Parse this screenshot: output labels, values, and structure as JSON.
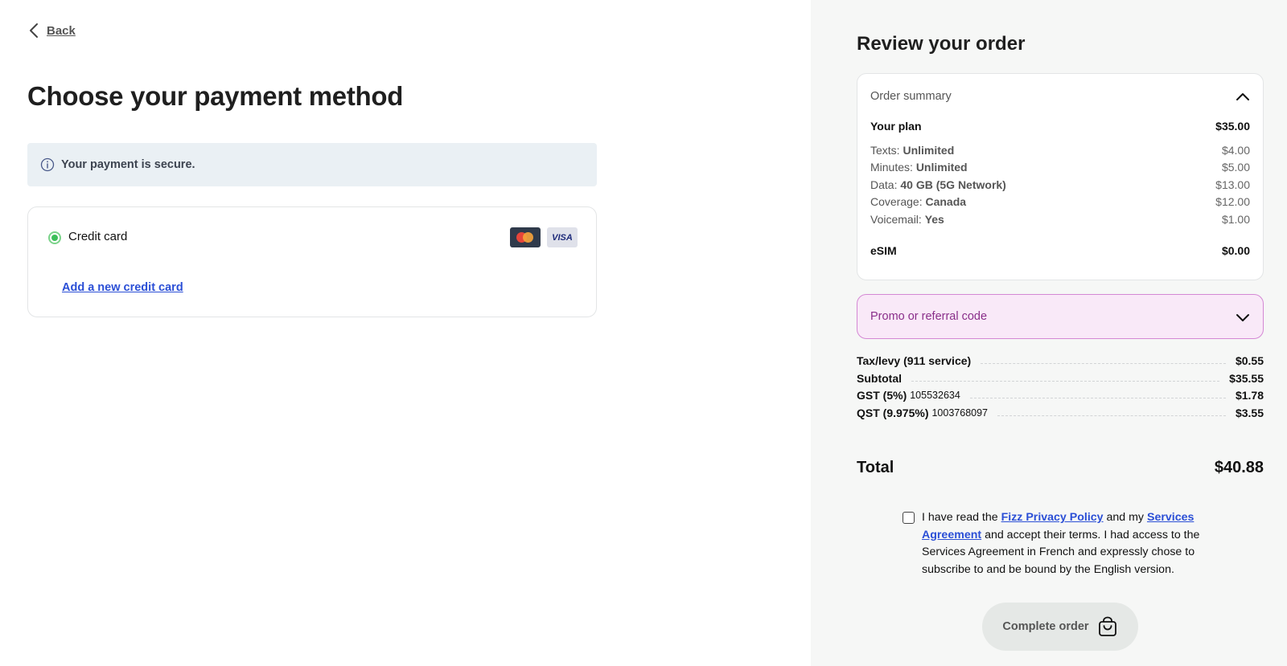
{
  "nav": {
    "back_label": "Back"
  },
  "payment": {
    "title": "Choose your payment method",
    "secure_text": "Your payment is secure.",
    "method_label": "Credit card",
    "visa_text": "VISA",
    "add_card_label": "Add a new credit card"
  },
  "review": {
    "title": "Review your order",
    "summary_heading": "Order summary",
    "plan": {
      "label": "Your plan",
      "value": "$35.00"
    },
    "features": [
      {
        "name": "Texts: ",
        "detail": "Unlimited",
        "price": "$4.00"
      },
      {
        "name": "Minutes: ",
        "detail": "Unlimited",
        "price": "$5.00"
      },
      {
        "name": "Data: ",
        "detail": "40 GB (5G Network)",
        "price": "$13.00"
      },
      {
        "name": "Coverage: ",
        "detail": "Canada",
        "price": "$12.00"
      },
      {
        "name": "Voicemail: ",
        "detail": "Yes",
        "price": "$1.00"
      }
    ],
    "esim": {
      "label": "eSIM",
      "value": "$0.00"
    },
    "promo_label": "Promo or referral code",
    "taxes": [
      {
        "label": "Tax/levy (911 service)",
        "number": "",
        "value": "$0.55"
      },
      {
        "label": "Subtotal",
        "number": "",
        "value": "$35.55"
      },
      {
        "label": "GST (5%)",
        "number": "105532634",
        "value": "$1.78"
      },
      {
        "label": "QST (9.975%)",
        "number": "1003768097",
        "value": "$3.55"
      }
    ],
    "total": {
      "label": "Total",
      "value": "$40.88"
    },
    "terms": {
      "prefix": "I have read the ",
      "privacy_link": "Fizz Privacy Policy",
      "middle": " and my ",
      "services_link": "Services Agreement",
      "suffix": " and accept their terms. I had access to the Services Agreement in French and expressly chose to subscribe to and be bound by the English version."
    },
    "complete_label": "Complete order"
  },
  "colors": {
    "accent_link": "#2b4fd6",
    "radio_green": "#3cbf5a",
    "promo_bg": "#f9e9f8",
    "promo_border": "#d488d4",
    "panel_bg": "#f6f7f6"
  }
}
